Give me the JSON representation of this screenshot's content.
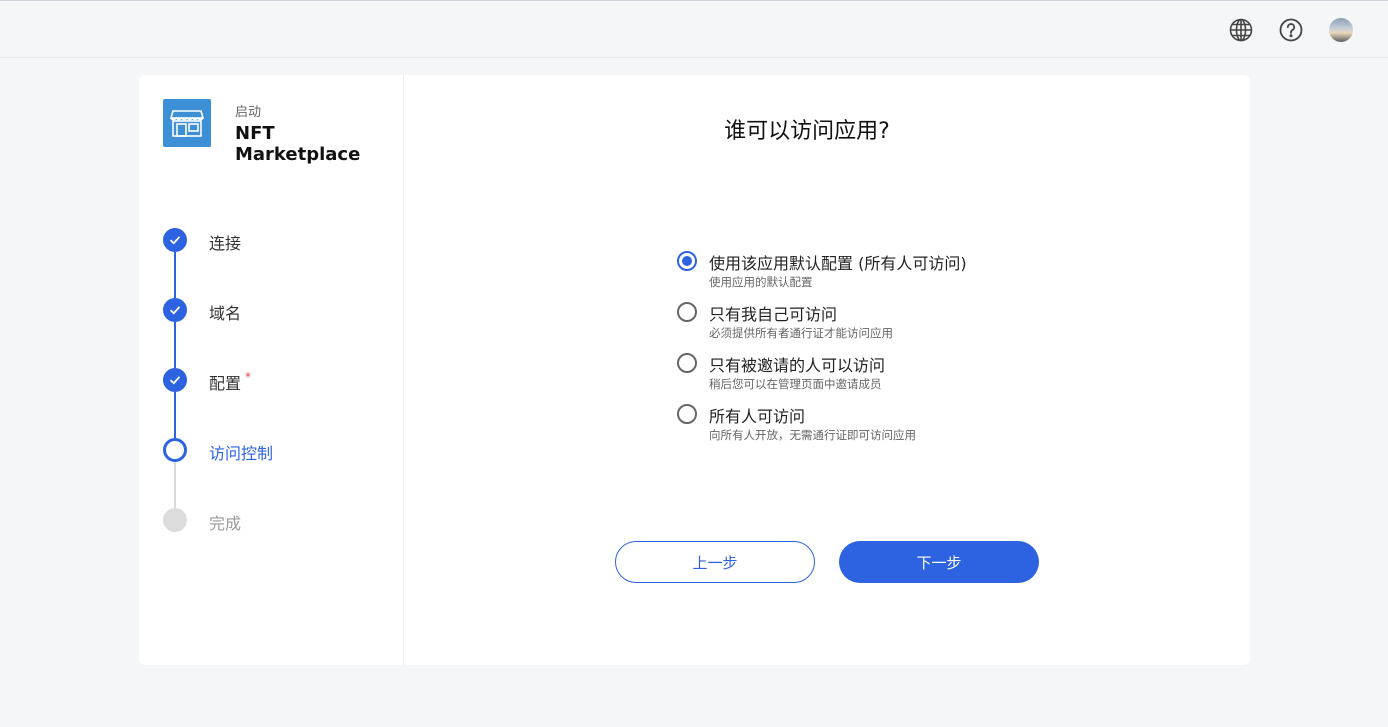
{
  "topbar": {
    "icons": [
      "globe-icon",
      "help-icon",
      "avatar"
    ]
  },
  "app": {
    "subtitle": "启动",
    "name": "NFT Marketplace",
    "logo_icon": "store-icon",
    "logo_color": "#3d8fd6"
  },
  "steps": [
    {
      "label": "连接",
      "state": "done"
    },
    {
      "label": "域名",
      "state": "done"
    },
    {
      "label": "配置",
      "state": "done",
      "required_mark": "*"
    },
    {
      "label": "访问控制",
      "state": "active"
    },
    {
      "label": "完成",
      "state": "todo"
    }
  ],
  "main": {
    "title": "谁可以访问应用?",
    "options": [
      {
        "label": "使用该应用默认配置 (所有人可访问)",
        "desc": "使用应用的默认配置",
        "checked": true
      },
      {
        "label": "只有我自己可访问",
        "desc": "必须提供所有者通行证才能访问应用",
        "checked": false
      },
      {
        "label": "只有被邀请的人可以访问",
        "desc": "稍后您可以在管理页面中邀请成员",
        "checked": false
      },
      {
        "label": "所有人可访问",
        "desc": "向所有人开放，无需通行证即可访问应用",
        "checked": false
      }
    ],
    "prev_label": "上一步",
    "next_label": "下一步"
  },
  "colors": {
    "accent": "#2d63e0",
    "required": "#e0494b",
    "pending": "#dcdcdc"
  }
}
